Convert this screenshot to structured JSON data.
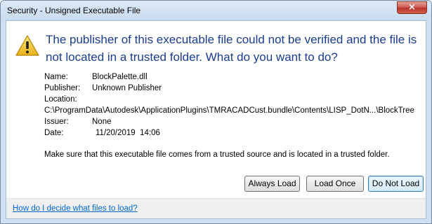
{
  "window": {
    "title": "Security - Unsigned Executable File",
    "close_label": "×"
  },
  "message": {
    "headline": "The publisher of this executable file could not be verified and the file is not located in a trusted folder. What do you want to do?",
    "icon": "warning-icon"
  },
  "details": {
    "name_label": "Name:",
    "name_value": "BlockPalette.dll",
    "publisher_label": "Publisher:",
    "publisher_value": "Unknown Publisher",
    "location_label": "Location:",
    "location_value": "C:\\ProgramData\\Autodesk\\ApplicationPlugins\\TMRACADCust.bundle\\Contents\\LISP_DotN...\\BlockTree",
    "issuer_label": "Issuer:",
    "issuer_value": "None",
    "date_label": "Date:",
    "date_value": "11/20/2019  14:06"
  },
  "note": "Make sure that this executable file comes from a trusted source and is located in a trusted folder.",
  "buttons": {
    "always_load": "Always Load",
    "load_once": "Load Once",
    "do_not_load": "Do Not Load"
  },
  "footer": {
    "help_link": "How do I decide what files to load?"
  },
  "colors": {
    "headline": "#1a3d8f",
    "link": "#0066cc",
    "close": "#c75050"
  }
}
